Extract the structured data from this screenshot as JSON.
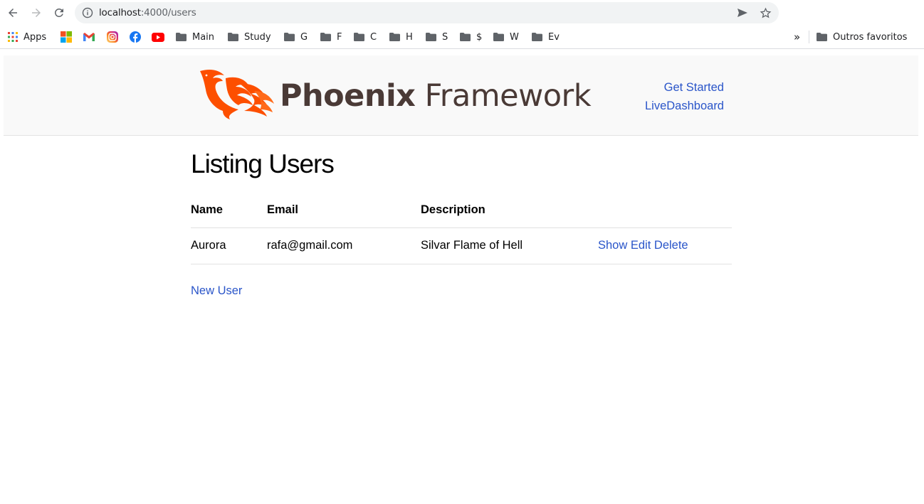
{
  "browser": {
    "url_host": "localhost",
    "url_path": ":4000/users",
    "bookmarks": [
      {
        "label": "Apps",
        "icon": "apps-grid-icon"
      },
      {
        "label": "",
        "icon": "microsoft-icon"
      },
      {
        "label": "",
        "icon": "gmail-icon"
      },
      {
        "label": "",
        "icon": "instagram-icon"
      },
      {
        "label": "",
        "icon": "facebook-icon"
      },
      {
        "label": "",
        "icon": "youtube-icon"
      },
      {
        "label": "Main",
        "icon": "folder-icon"
      },
      {
        "label": "Study",
        "icon": "folder-icon"
      },
      {
        "label": "G",
        "icon": "folder-icon"
      },
      {
        "label": "F",
        "icon": "folder-icon"
      },
      {
        "label": "C",
        "icon": "folder-icon"
      },
      {
        "label": "H",
        "icon": "folder-icon"
      },
      {
        "label": "S",
        "icon": "folder-icon"
      },
      {
        "label": "$",
        "icon": "folder-icon"
      },
      {
        "label": "W",
        "icon": "folder-icon"
      },
      {
        "label": "Ev",
        "icon": "folder-icon"
      }
    ],
    "overflow_label": "»",
    "other_bookmarks": "Outros favoritos"
  },
  "header": {
    "logo_bold": "Phoenix",
    "logo_light": " Framework",
    "links": [
      "Get Started",
      "LiveDashboard"
    ]
  },
  "main": {
    "title": "Listing Users",
    "columns": [
      "Name",
      "Email",
      "Description"
    ],
    "rows": [
      {
        "name": "Aurora",
        "email": "rafa@gmail.com",
        "description": "Silvar Flame of Hell",
        "actions": [
          "Show",
          "Edit",
          "Delete"
        ]
      }
    ],
    "new_link": "New User"
  },
  "colors": {
    "link": "#2a55c9",
    "phoenix_orange": "#fd4f00",
    "logo_text": "#4a3a36"
  }
}
